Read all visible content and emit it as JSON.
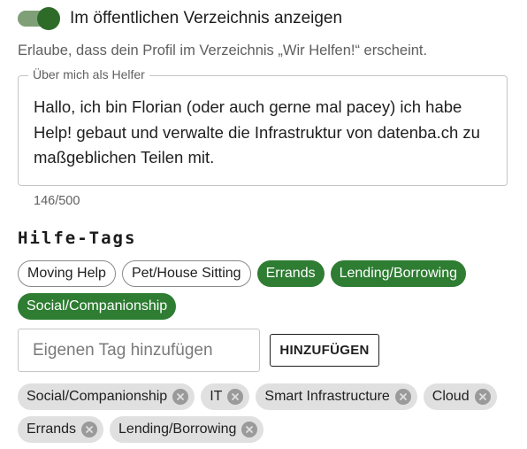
{
  "visibility": {
    "toggle_label": "Im öffentlichen Verzeichnis anzeigen",
    "toggle_on": true,
    "helper": "Erlaube, dass dein Profil im Verzeichnis „Wir Helfen!“ erscheint."
  },
  "about": {
    "legend": "Über mich als Helfer",
    "value": "Hallo, ich bin Florian (oder auch gerne mal pacey) ich habe Help! gebaut und verwalte die Infrastruktur von datenba.ch zu maßgeblichen Teilen mit.",
    "counter": "146/500"
  },
  "tags_section": {
    "title": "Hilfe-Tags",
    "suggestions": [
      {
        "label": "Moving Help",
        "selected": false
      },
      {
        "label": "Pet/House Sitting",
        "selected": false
      },
      {
        "label": "Errands",
        "selected": true
      },
      {
        "label": "Lending/Borrowing",
        "selected": true
      },
      {
        "label": "Social/Companionship",
        "selected": true
      }
    ],
    "custom_placeholder": "Eigenen Tag hinzufügen",
    "add_label": "HINZUFÜGEN",
    "my_tags": [
      {
        "label": "Social/Companionship",
        "icon": "remove-icon"
      },
      {
        "label": "IT",
        "icon": "remove-icon"
      },
      {
        "label": "Smart Infrastructure",
        "icon": "remove-icon"
      },
      {
        "label": "Cloud",
        "icon": "remove-icon"
      },
      {
        "label": "Errands",
        "icon": "remove-icon"
      },
      {
        "label": "Lending/Borrowing",
        "icon": "remove-icon"
      }
    ]
  },
  "colors": {
    "accent": "#2e7d32",
    "toggle_track": "#7f9f76",
    "toggle_knob": "#2e6b28",
    "chip_grey": "#e0e0e0"
  }
}
